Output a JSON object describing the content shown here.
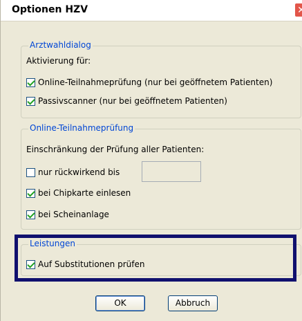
{
  "window": {
    "title": "Optionen HZV",
    "close_glyph": "✕"
  },
  "arztwahl": {
    "legend": "Arztwahldialog",
    "intro": "Aktivierung für:",
    "options": [
      {
        "label": "Online-Teilnahmeprüfung (nur bei geöffnetem Patienten)",
        "checked": true
      },
      {
        "label": "Passivscanner (nur bei geöffnetem Patienten)",
        "checked": true
      }
    ]
  },
  "online": {
    "legend": "Online-Teilnahmeprüfung",
    "intro": "Einschränkung der Prüfung aller Patienten:",
    "rueckwirkend_label": "nur rückwirkend bis",
    "rueckwirkend_checked": false,
    "rueckwirkend_value": "",
    "options": [
      {
        "label": "bei Chipkarte einlesen",
        "checked": true
      },
      {
        "label": "bei Scheinanlage",
        "checked": true
      }
    ]
  },
  "leistungen": {
    "legend": "Leistungen",
    "option": {
      "label": "Auf Substitutionen prüfen",
      "checked": true
    }
  },
  "buttons": {
    "ok": "OK",
    "cancel": "Abbruch"
  },
  "colors": {
    "dialog_bg": "#ece9d8",
    "legend": "#0046d5",
    "highlight_border": "#10106e",
    "check": "#21a121"
  }
}
